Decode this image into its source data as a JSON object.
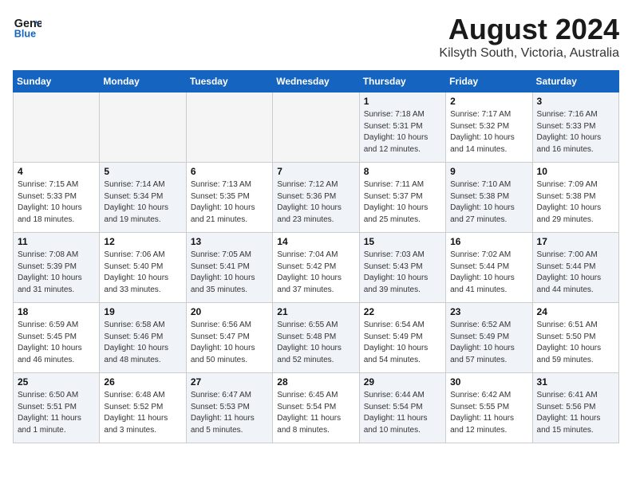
{
  "header": {
    "logo_line1": "General",
    "logo_line2": "Blue",
    "month": "August 2024",
    "location": "Kilsyth South, Victoria, Australia"
  },
  "days_of_week": [
    "Sunday",
    "Monday",
    "Tuesday",
    "Wednesday",
    "Thursday",
    "Friday",
    "Saturday"
  ],
  "weeks": [
    [
      {
        "day": "",
        "info": ""
      },
      {
        "day": "",
        "info": ""
      },
      {
        "day": "",
        "info": ""
      },
      {
        "day": "",
        "info": ""
      },
      {
        "day": "1",
        "info": "Sunrise: 7:18 AM\nSunset: 5:31 PM\nDaylight: 10 hours\nand 12 minutes."
      },
      {
        "day": "2",
        "info": "Sunrise: 7:17 AM\nSunset: 5:32 PM\nDaylight: 10 hours\nand 14 minutes."
      },
      {
        "day": "3",
        "info": "Sunrise: 7:16 AM\nSunset: 5:33 PM\nDaylight: 10 hours\nand 16 minutes."
      }
    ],
    [
      {
        "day": "4",
        "info": "Sunrise: 7:15 AM\nSunset: 5:33 PM\nDaylight: 10 hours\nand 18 minutes."
      },
      {
        "day": "5",
        "info": "Sunrise: 7:14 AM\nSunset: 5:34 PM\nDaylight: 10 hours\nand 19 minutes."
      },
      {
        "day": "6",
        "info": "Sunrise: 7:13 AM\nSunset: 5:35 PM\nDaylight: 10 hours\nand 21 minutes."
      },
      {
        "day": "7",
        "info": "Sunrise: 7:12 AM\nSunset: 5:36 PM\nDaylight: 10 hours\nand 23 minutes."
      },
      {
        "day": "8",
        "info": "Sunrise: 7:11 AM\nSunset: 5:37 PM\nDaylight: 10 hours\nand 25 minutes."
      },
      {
        "day": "9",
        "info": "Sunrise: 7:10 AM\nSunset: 5:38 PM\nDaylight: 10 hours\nand 27 minutes."
      },
      {
        "day": "10",
        "info": "Sunrise: 7:09 AM\nSunset: 5:38 PM\nDaylight: 10 hours\nand 29 minutes."
      }
    ],
    [
      {
        "day": "11",
        "info": "Sunrise: 7:08 AM\nSunset: 5:39 PM\nDaylight: 10 hours\nand 31 minutes."
      },
      {
        "day": "12",
        "info": "Sunrise: 7:06 AM\nSunset: 5:40 PM\nDaylight: 10 hours\nand 33 minutes."
      },
      {
        "day": "13",
        "info": "Sunrise: 7:05 AM\nSunset: 5:41 PM\nDaylight: 10 hours\nand 35 minutes."
      },
      {
        "day": "14",
        "info": "Sunrise: 7:04 AM\nSunset: 5:42 PM\nDaylight: 10 hours\nand 37 minutes."
      },
      {
        "day": "15",
        "info": "Sunrise: 7:03 AM\nSunset: 5:43 PM\nDaylight: 10 hours\nand 39 minutes."
      },
      {
        "day": "16",
        "info": "Sunrise: 7:02 AM\nSunset: 5:44 PM\nDaylight: 10 hours\nand 41 minutes."
      },
      {
        "day": "17",
        "info": "Sunrise: 7:00 AM\nSunset: 5:44 PM\nDaylight: 10 hours\nand 44 minutes."
      }
    ],
    [
      {
        "day": "18",
        "info": "Sunrise: 6:59 AM\nSunset: 5:45 PM\nDaylight: 10 hours\nand 46 minutes."
      },
      {
        "day": "19",
        "info": "Sunrise: 6:58 AM\nSunset: 5:46 PM\nDaylight: 10 hours\nand 48 minutes."
      },
      {
        "day": "20",
        "info": "Sunrise: 6:56 AM\nSunset: 5:47 PM\nDaylight: 10 hours\nand 50 minutes."
      },
      {
        "day": "21",
        "info": "Sunrise: 6:55 AM\nSunset: 5:48 PM\nDaylight: 10 hours\nand 52 minutes."
      },
      {
        "day": "22",
        "info": "Sunrise: 6:54 AM\nSunset: 5:49 PM\nDaylight: 10 hours\nand 54 minutes."
      },
      {
        "day": "23",
        "info": "Sunrise: 6:52 AM\nSunset: 5:49 PM\nDaylight: 10 hours\nand 57 minutes."
      },
      {
        "day": "24",
        "info": "Sunrise: 6:51 AM\nSunset: 5:50 PM\nDaylight: 10 hours\nand 59 minutes."
      }
    ],
    [
      {
        "day": "25",
        "info": "Sunrise: 6:50 AM\nSunset: 5:51 PM\nDaylight: 11 hours\nand 1 minute."
      },
      {
        "day": "26",
        "info": "Sunrise: 6:48 AM\nSunset: 5:52 PM\nDaylight: 11 hours\nand 3 minutes."
      },
      {
        "day": "27",
        "info": "Sunrise: 6:47 AM\nSunset: 5:53 PM\nDaylight: 11 hours\nand 5 minutes."
      },
      {
        "day": "28",
        "info": "Sunrise: 6:45 AM\nSunset: 5:54 PM\nDaylight: 11 hours\nand 8 minutes."
      },
      {
        "day": "29",
        "info": "Sunrise: 6:44 AM\nSunset: 5:54 PM\nDaylight: 11 hours\nand 10 minutes."
      },
      {
        "day": "30",
        "info": "Sunrise: 6:42 AM\nSunset: 5:55 PM\nDaylight: 11 hours\nand 12 minutes."
      },
      {
        "day": "31",
        "info": "Sunrise: 6:41 AM\nSunset: 5:56 PM\nDaylight: 11 hours\nand 15 minutes."
      }
    ]
  ]
}
